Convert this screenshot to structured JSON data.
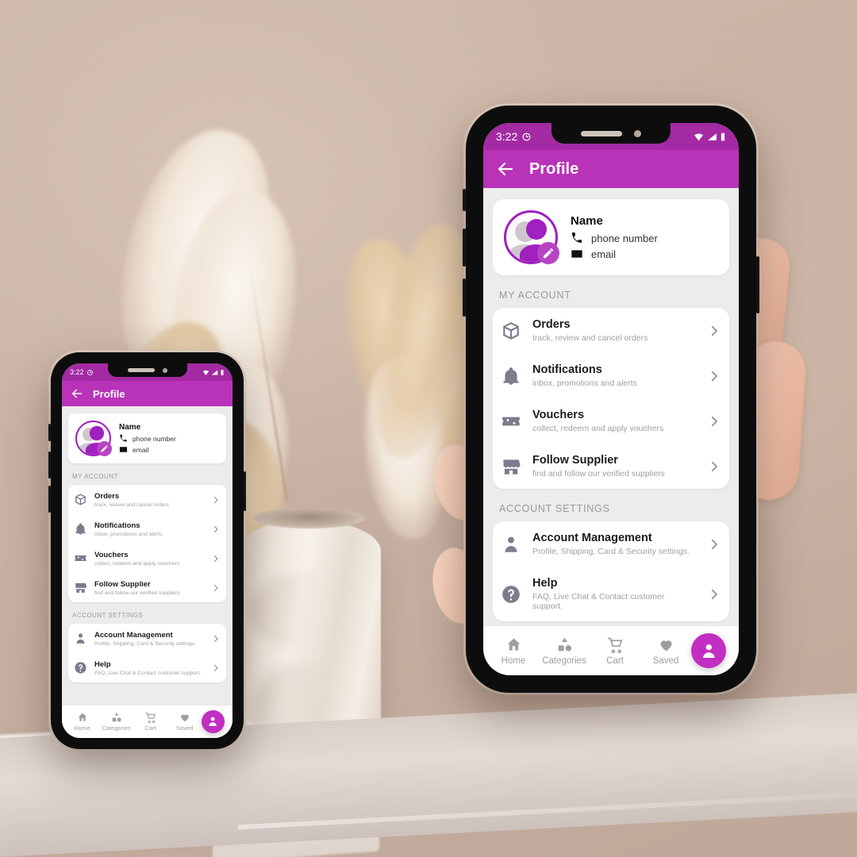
{
  "app": {
    "accent_purple": "#b833b8",
    "statusbar_purple": "#a32aa3",
    "fab_purple": "#c22ec2",
    "screen_bg": "#ececec",
    "icon_gray": "#7c7c8e"
  },
  "status_bar": {
    "time": "3:22",
    "left_icon": "alarm-icon",
    "right_icons": [
      "wifi-icon",
      "signal-icon",
      "battery-icon"
    ]
  },
  "appbar": {
    "back_icon": "back-arrow-icon",
    "title": "Profile"
  },
  "profile": {
    "avatar_icon": "user-avatar-icon",
    "edit_icon": "pencil-icon",
    "name": "Name",
    "phone_icon": "phone-icon",
    "phone": "phone number",
    "email_icon": "envelope-icon",
    "email": "email"
  },
  "sections": [
    {
      "title": "MY ACCOUNT",
      "items": [
        {
          "icon": "package-icon",
          "title": "Orders",
          "subtitle": "track, review and cancel orders"
        },
        {
          "icon": "bell-icon",
          "title": "Notifications",
          "subtitle": "inbox, promotions and alerts"
        },
        {
          "icon": "voucher-icon",
          "title": "Vouchers",
          "subtitle": "collect, redeem and apply vouchers"
        },
        {
          "icon": "store-icon",
          "title": "Follow Supplier",
          "subtitle": "find and follow our verified suppliers"
        }
      ]
    },
    {
      "title": "ACCOUNT SETTINGS",
      "items": [
        {
          "icon": "person-icon",
          "title": "Account Management",
          "subtitle": "Profile, Shipping, Card & Security settings."
        },
        {
          "icon": "question-icon",
          "title": "Help",
          "subtitle": "FAQ, Live Chat & Contact customer support."
        }
      ]
    }
  ],
  "bottom_nav": {
    "items": [
      {
        "icon": "home-icon",
        "label": "Home"
      },
      {
        "icon": "categories-icon",
        "label": "Categories"
      },
      {
        "icon": "cart-icon",
        "label": "Cart"
      },
      {
        "icon": "heart-icon",
        "label": "Saved"
      }
    ],
    "fab_icon": "account-icon"
  }
}
